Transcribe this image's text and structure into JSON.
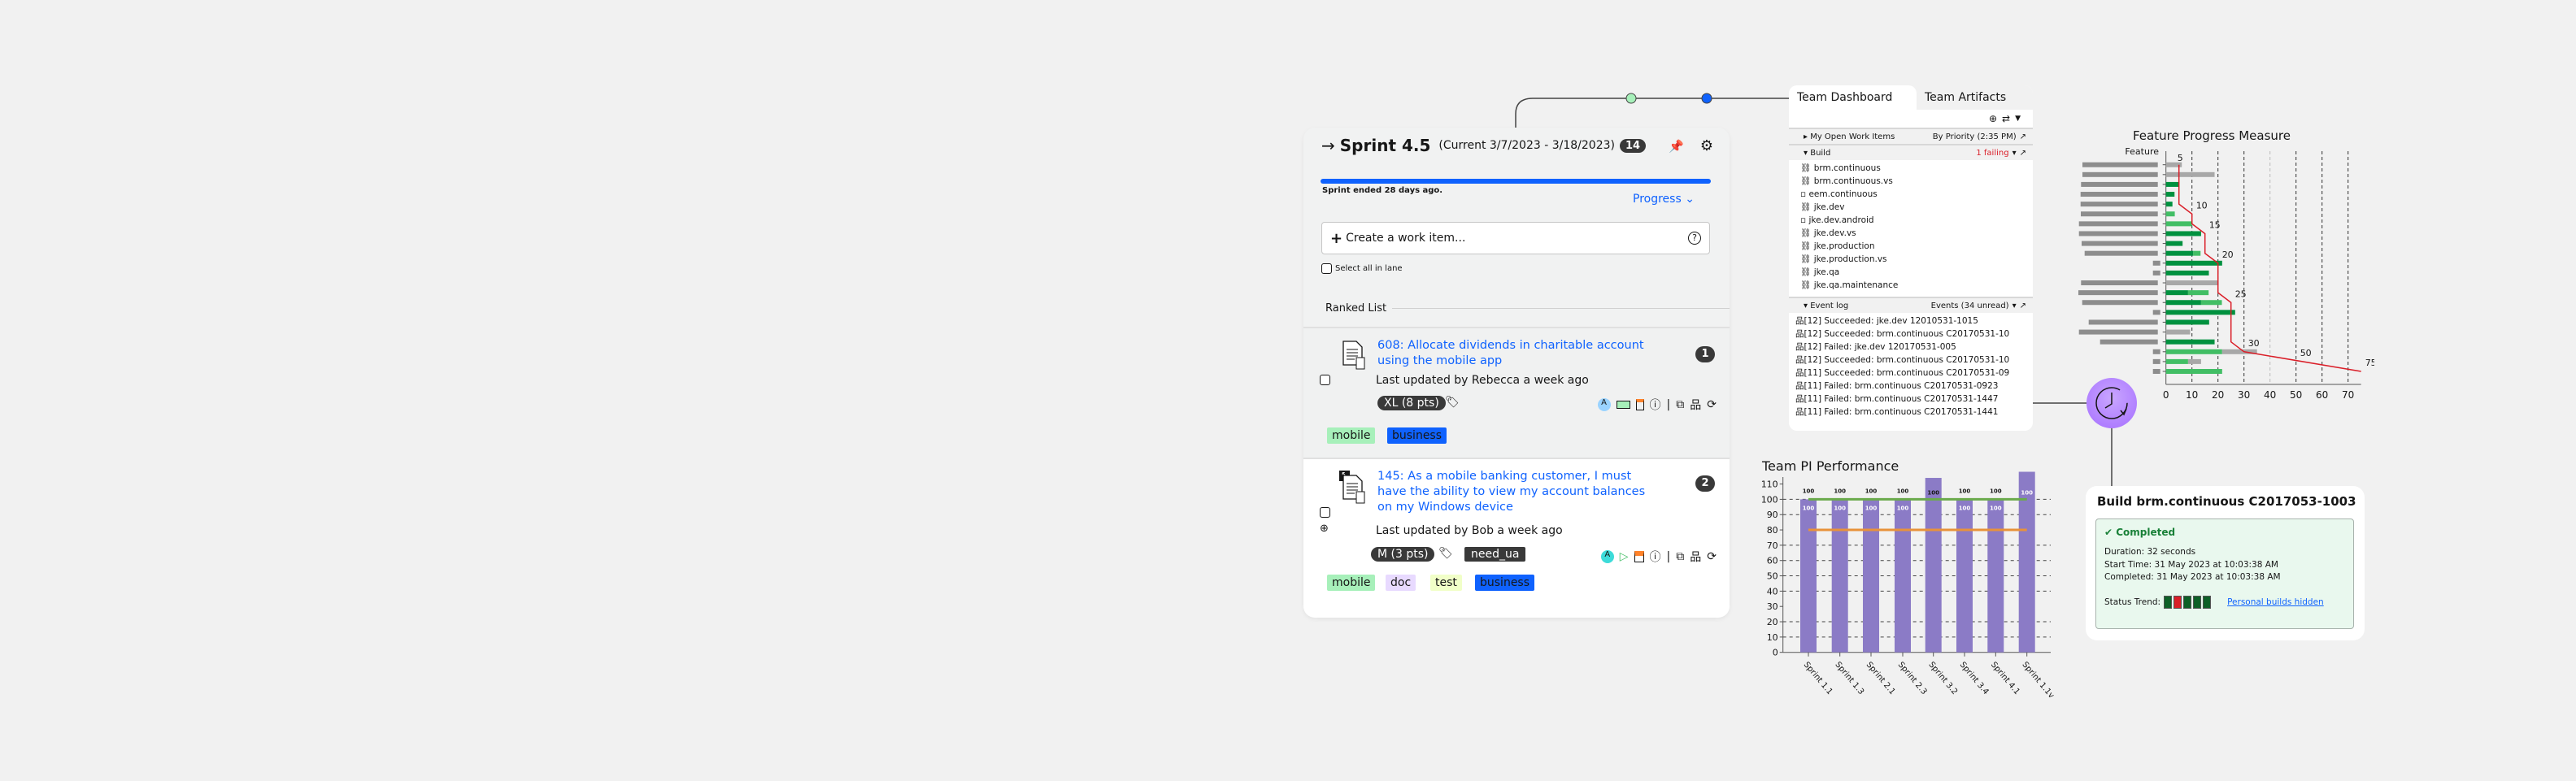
{
  "sprint": {
    "title": "Sprint 4.5",
    "dates": "(Current 3/7/2023 - 3/18/2023)",
    "count": "14",
    "progress_percent": 100,
    "ended": "Sprint ended 28 days ago.",
    "progress_link": "Progress",
    "create_placeholder": "Create a work item...",
    "select_all": "Select all in lane",
    "ranked_list": "Ranked List",
    "items": [
      {
        "title": "608: Allocate dividends in charitable account using the mobile app",
        "rank": "1",
        "updated": "Last updated by Rebecca a week ago",
        "size": "XL (8 pts)",
        "tags": [
          "mobile",
          "business"
        ]
      },
      {
        "title": "145: As a mobile banking customer, I must have the ability to view my account balances on my Windows device",
        "rank": "2",
        "updated": "Last updated by Bob a week ago",
        "size": "M (3 pts)",
        "label": "need_ua",
        "tags": [
          "mobile",
          "doc",
          "test",
          "business"
        ]
      }
    ]
  },
  "colors": {
    "accent": "#0f62fe",
    "tag_mobile": "#a7f0ba",
    "tag_doc": "#e8daff",
    "tag_test": "#f1ffc8",
    "tag_business": "#0f62fe",
    "failing": "#da1e28",
    "success": "#198038"
  },
  "dashboard": {
    "tabs": [
      "Team Dashboard",
      "Team Artifacts"
    ],
    "open_items": {
      "title": "My Open Work Items",
      "right": "By Priority (2:35 PM)"
    },
    "build": {
      "title": "Build",
      "status": "1 failing",
      "items": [
        "brm.continuous",
        "brm.continuous.vs",
        "eem.continuous",
        "jke.dev",
        "jke.dev.android",
        "jke.dev.vs",
        "jke.production",
        "jke.production.vs",
        "jke.qa",
        "jke.qa.maintenance"
      ]
    },
    "event_log": {
      "title": "Event log",
      "right": "Events (34 unread)",
      "events": [
        "[12] Succeeded: jke.dev 12010531-1015",
        "[12] Succeeded: brm.continuous C20170531-10",
        "[12] Failed: jke.dev 120170531-005",
        "[12] Succeeded: brm.continuous C20170531-10",
        "[11] Succeeded: brm.continuous C20170531-09",
        "[11] Failed: brm.continuous C20170531-0923",
        "[11] Failed: brm.continuous C20170531-1447",
        "[11] Failed: brm.continuous C20170531-1441"
      ]
    }
  },
  "build_popup": {
    "title": "Build brm.continuous C2017053-1003",
    "status": "Completed",
    "duration": "Duration: 32 seconds",
    "start": "Start Time: 31 May 2023 at 10:03:38 AM",
    "completed": "Completed: 31 May 2023 at 10:03:38 AM",
    "trend_label": "Status Trend:",
    "trend": [
      "success",
      "failed",
      "success",
      "success",
      "success"
    ],
    "link": "Personal builds hidden"
  },
  "chart_data": [
    {
      "type": "bar",
      "orientation": "horizontal",
      "title": "Feature Progress Measure",
      "ylabel": "Feature",
      "xlim": [
        0,
        75
      ],
      "xticks": [
        0,
        10,
        20,
        30,
        40,
        50,
        60,
        70
      ],
      "grid": true,
      "series": [
        {
          "color": "#00913f",
          "values": [
            0,
            0,
            4.9,
            3.3,
            2.5,
            0,
            0,
            13.5,
            6.4,
            10.5,
            21.6,
            16.5,
            0,
            8.5,
            13.5,
            26.6,
            16.6,
            0,
            18.7,
            0,
            0,
            0
          ]
        },
        {
          "color": "#42be65",
          "values": [
            0,
            0,
            0,
            0,
            0,
            3.4,
            10,
            0,
            0,
            2.8,
            0,
            0,
            0,
            7.9,
            8,
            0,
            0,
            0,
            0,
            21.6,
            8.5,
            21.6
          ]
        },
        {
          "color": "#a8a8a8",
          "values": [
            6.1,
            18.7,
            0,
            0,
            0,
            0,
            0,
            0,
            0,
            0,
            0,
            0,
            20.2,
            0,
            0,
            0,
            0,
            9.3,
            0,
            13.4,
            5,
            0
          ]
        }
      ],
      "target_line": {
        "color": "#da1e28",
        "points": [
          [
            5,
            1
          ],
          [
            5,
            5
          ],
          [
            10,
            6
          ],
          [
            10,
            7
          ],
          [
            15,
            8
          ],
          [
            15,
            10
          ],
          [
            20,
            11
          ],
          [
            20,
            14
          ],
          [
            25,
            15
          ],
          [
            25,
            19
          ],
          [
            30,
            20
          ],
          [
            75,
            22
          ]
        ],
        "labels": [
          "5",
          "10",
          "15",
          "20",
          "25",
          "30",
          "50",
          "75"
        ]
      }
    },
    {
      "type": "bar",
      "title": "Team PI Performance",
      "categories": [
        "Sprint 1.1",
        "Sprint 1.3",
        "Sprint 2.1",
        "Sprint 2.3",
        "Sprint 3.2",
        "Sprint 3.4",
        "Sprint 4.1",
        "Sprint 1.1v"
      ],
      "values": [
        100,
        100,
        100,
        100,
        114,
        100,
        100,
        118
      ],
      "data_labels": [
        "100",
        "100",
        "100",
        "100",
        "100",
        "100",
        "100",
        "100"
      ],
      "ylim": [
        0,
        115
      ],
      "yticks": [
        0,
        10,
        20,
        30,
        40,
        50,
        60,
        70,
        80,
        90,
        100,
        110
      ],
      "bar_color": "#8b7bc6",
      "reference_lines": [
        {
          "value": 100,
          "color": "#6aaa4b"
        },
        {
          "value": 80,
          "color": "#e8923a"
        }
      ],
      "grid": true
    }
  ]
}
